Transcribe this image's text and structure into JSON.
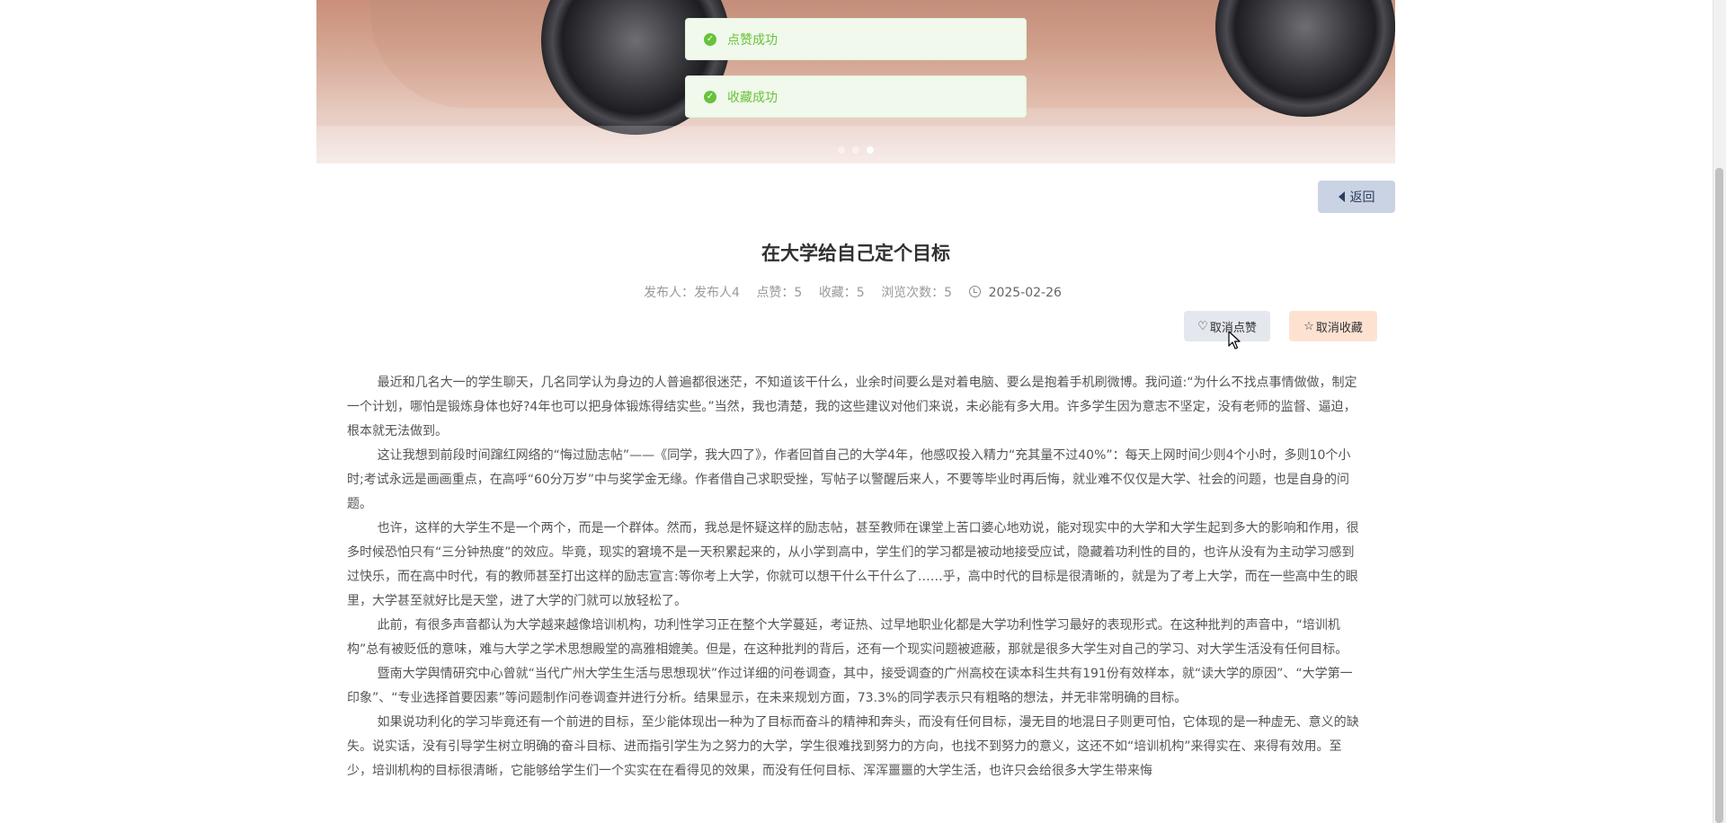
{
  "toasts": [
    {
      "text": "点赞成功"
    },
    {
      "text": "收藏成功"
    }
  ],
  "carousel": {
    "slide_count": 3,
    "active_index": 2
  },
  "back_label": "返回",
  "article": {
    "title": "在大学给自己定个目标",
    "publisher": "发布人：发布人4",
    "likes": "点赞：5",
    "favorites": "收藏：5",
    "views": "浏览次数：5",
    "date": "2025-02-26"
  },
  "actions": {
    "unlike_label": "取消点赞",
    "unfavorite_label": "取消收藏"
  },
  "content": {
    "paragraphs": [
      "最近和几名大一的学生聊天，几名同学认为身边的人普遍都很迷茫，不知道该干什么，业余时间要么是对着电脑、要么是抱着手机刷微博。我问道:“为什么不找点事情做做，制定一个计划，哪怕是锻炼身体也好?4年也可以把身体锻炼得结实些。”当然，我也清楚，我的这些建议对他们来说，未必能有多大用。许多学生因为意志不坚定，没有老师的监督、逼迫，根本就无法做到。",
      " 这让我想到前段时间蹿红网络的“悔过励志帖”——《同学，我大四了》，作者回首自己的大学4年，他感叹投入精力“充其量不过40%”：每天上网时间少则4个小时，多则10个小时;考试永远是画画重点，在高呼“60分万岁”中与奖学金无缘。作者借自己求职受挫，写帖子以警醒后来人，不要等毕业时再后悔，就业难不仅仅是大学、社会的问题，也是自身的问题。",
      "也许，这样的大学生不是一个两个，而是一个群体。然而，我总是怀疑这样的励志帖，甚至教师在课堂上苦口婆心地劝说，能对现实中的大学和大学生起到多大的影响和作用，很多时候恐怕只有“三分钟热度”的效应。毕竟，现实的窘境不是一天积累起来的，从小学到高中，学生们的学习都是被动地接受应试，隐藏着功利性的目的，也许从没有为主动学习感到过快乐，而在高中时代，有的教师甚至打出这样的励志宣言:等你考上大学，你就可以想干什么干什么了……乎，高中时代的目标是很清晰的，就是为了考上大学，而在一些高中生的眼里，大学甚至就好比是天堂，进了大学的门就可以放轻松了。",
      "此前，有很多声音都认为大学越来越像培训机构，功利性学习正在整个大学蔓延，考证热、过早地职业化都是大学功利性学习最好的表现形式。在这种批判的声音中，“培训机构”总有被贬低的意味，难与大学之学术思想殿堂的高雅相媲美。但是，在这种批判的背后，还有一个现实问题被遮蔽，那就是很多大学生对自己的学习、对大学生活没有任何目标。",
      "暨南大学舆情研究中心曾就“当代广州大学生生活与思想现状”作过详细的问卷调查，其中，接受调查的广州高校在读本科生共有191份有效样本，就“读大学的原因”、“大学第一印象”、“专业选择首要因素”等问题制作问卷调查并进行分析。结果显示，在未来规划方面，73.3%的同学表示只有粗略的想法，并无非常明确的目标。",
      " 如果说功利化的学习毕竟还有一个前进的目标，至少能体现出一种为了目标而奋斗的精神和奔头，而没有任何目标，漫无目的地混日子则更可怕，它体现的是一种虚无、意义的缺失。说实话，没有引导学生树立明确的奋斗目标、进而指引学生为之努力的大学，学生很难找到努力的方向，也找不到努力的意义，这还不如“培训机构”来得实在、来得有效用。至少，培训机构的目标很清晰，它能够给学生们一个实实在在看得见的效果，而没有任何目标、浑浑噩噩的大学生活，也许只会给很多大学生带来悔"
    ]
  }
}
